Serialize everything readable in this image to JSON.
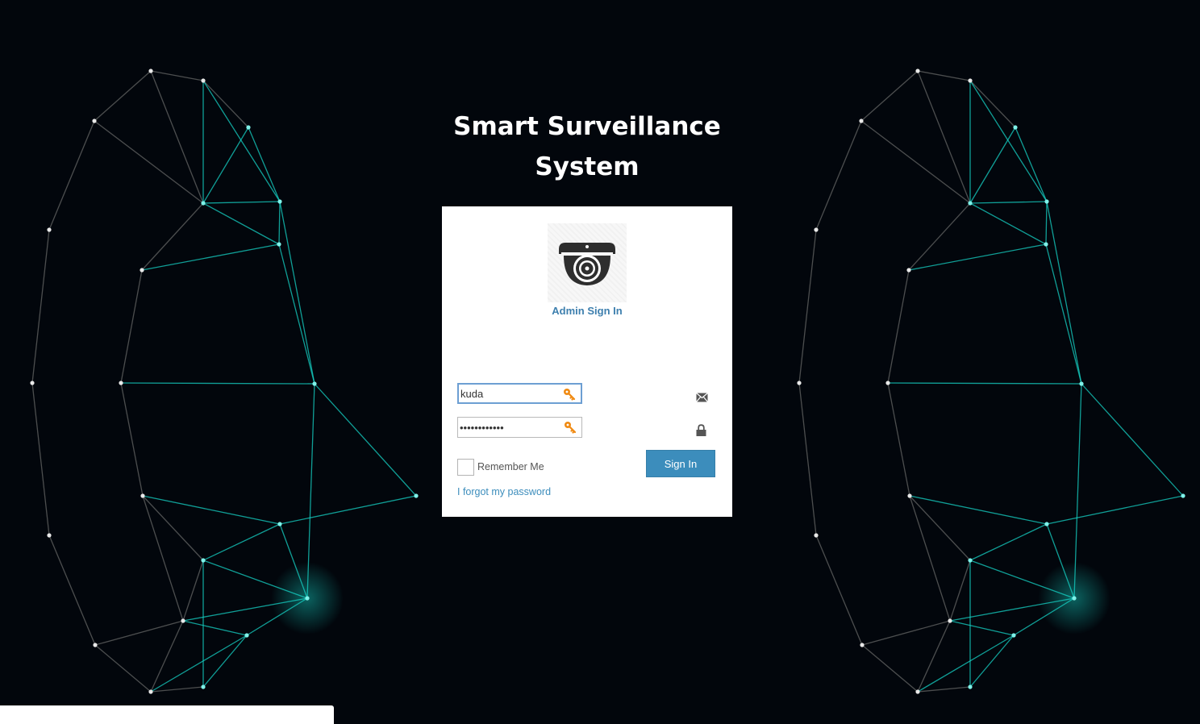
{
  "header": {
    "title_line1": "Smart Surveillance",
    "title_line2": "System"
  },
  "card": {
    "logo_icon": "dome-camera-icon",
    "subtitle": "Admin Sign In",
    "username": {
      "value": "kuda",
      "icon": "key-icon",
      "side_icon": "envelope-icon"
    },
    "password": {
      "value": "************",
      "icon": "key-icon",
      "side_icon": "lock-icon"
    },
    "remember_label": "Remember Me",
    "remember_checked": false,
    "signin_label": "Sign In",
    "forgot_label": "I forgot my password"
  },
  "colors": {
    "background": "#02060c",
    "accent": "#3c8dbc",
    "network_teal": "#16d3c6",
    "network_gray": "#8a8a86",
    "key_orange": "#f08a12"
  }
}
